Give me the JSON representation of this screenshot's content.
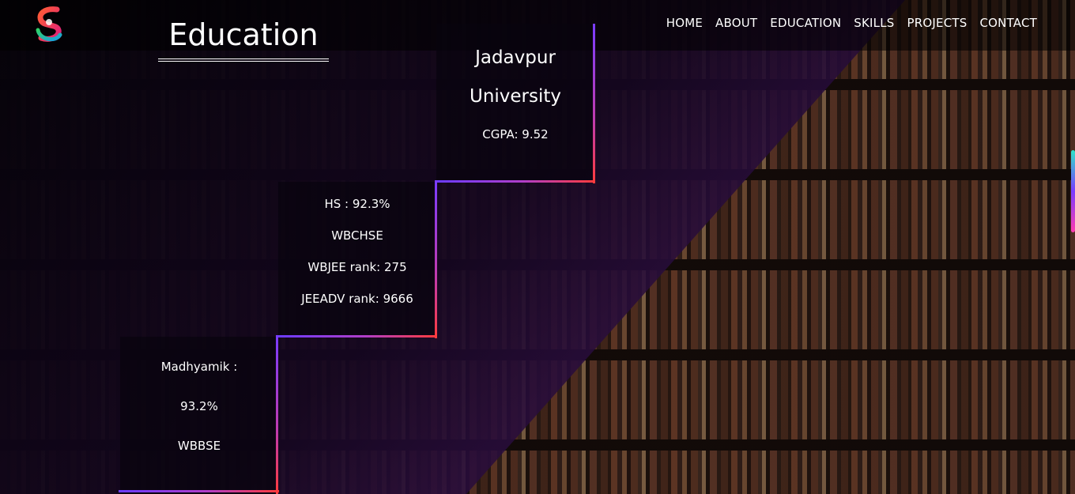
{
  "nav": {
    "items": [
      {
        "label": "HOME"
      },
      {
        "label": "ABOUT"
      },
      {
        "label": "EDUCATION"
      },
      {
        "label": "SKILLS"
      },
      {
        "label": "PROJECTS"
      },
      {
        "label": "CONTACT"
      }
    ]
  },
  "section": {
    "title": "Education"
  },
  "steps": {
    "university": {
      "line1": "Jadavpur",
      "line2": "University",
      "detail": "CGPA: 9.52"
    },
    "hs": {
      "score": "HS : 92.3%",
      "board": "WBCHSE",
      "wbjee": "WBJEE rank: 275",
      "jeeadv": "JEEADV rank: 9666"
    },
    "madhyamik": {
      "label": "Madhyamik :",
      "score": "93.2%",
      "board": "WBBSE"
    }
  },
  "colors": {
    "accent_start": "#7a3cff",
    "accent_end": "#ff3b3b"
  },
  "icons": {
    "logo": "brand-logo-icon"
  }
}
